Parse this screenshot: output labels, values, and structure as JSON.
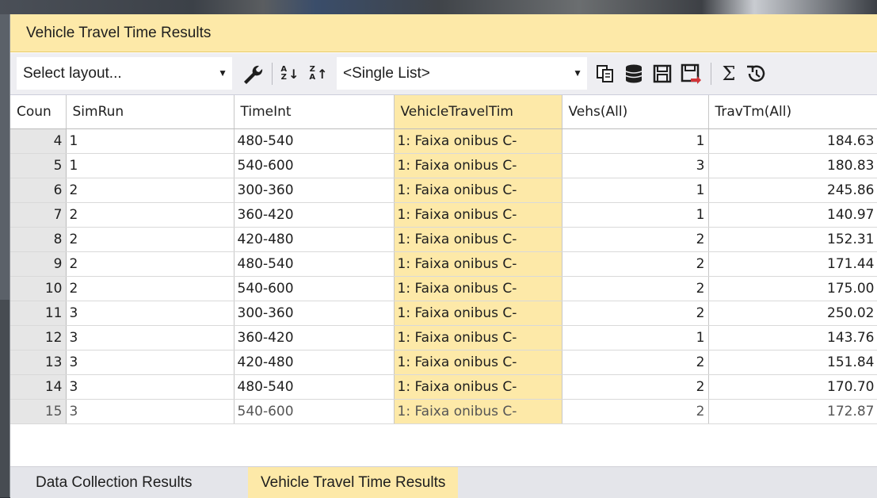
{
  "window": {
    "title": "Vehicle Travel Time Results"
  },
  "toolbar": {
    "layout_select": "Select layout...",
    "list_select": "<Single List>",
    "icons": [
      "wrench-icon",
      "sort-ascending-icon",
      "sort-descending-icon",
      "copy-icon",
      "database-icon",
      "save-icon",
      "save-export-icon",
      "sum-icon",
      "history-icon"
    ]
  },
  "table": {
    "columns": [
      "Coun",
      "SimRun",
      "TimeInt",
      "VehicleTravelTim",
      "Vehs(All)",
      "TravTm(All)"
    ],
    "rows": [
      {
        "count": "4",
        "simrun": "1",
        "timeint": "480-540",
        "vtt": "1: Faixa onibus C-",
        "vehs": "1",
        "travtm": "184.63"
      },
      {
        "count": "5",
        "simrun": "1",
        "timeint": "540-600",
        "vtt": "1: Faixa onibus C-",
        "vehs": "3",
        "travtm": "180.83"
      },
      {
        "count": "6",
        "simrun": "2",
        "timeint": "300-360",
        "vtt": "1: Faixa onibus C-",
        "vehs": "1",
        "travtm": "245.86"
      },
      {
        "count": "7",
        "simrun": "2",
        "timeint": "360-420",
        "vtt": "1: Faixa onibus C-",
        "vehs": "1",
        "travtm": "140.97"
      },
      {
        "count": "8",
        "simrun": "2",
        "timeint": "420-480",
        "vtt": "1: Faixa onibus C-",
        "vehs": "2",
        "travtm": "152.31"
      },
      {
        "count": "9",
        "simrun": "2",
        "timeint": "480-540",
        "vtt": "1: Faixa onibus C-",
        "vehs": "2",
        "travtm": "171.44"
      },
      {
        "count": "10",
        "simrun": "2",
        "timeint": "540-600",
        "vtt": "1: Faixa onibus C-",
        "vehs": "2",
        "travtm": "175.00"
      },
      {
        "count": "11",
        "simrun": "3",
        "timeint": "300-360",
        "vtt": "1: Faixa onibus C-",
        "vehs": "2",
        "travtm": "250.02"
      },
      {
        "count": "12",
        "simrun": "3",
        "timeint": "360-420",
        "vtt": "1: Faixa onibus C-",
        "vehs": "1",
        "travtm": "143.76"
      },
      {
        "count": "13",
        "simrun": "3",
        "timeint": "420-480",
        "vtt": "1: Faixa onibus C-",
        "vehs": "2",
        "travtm": "151.84"
      },
      {
        "count": "14",
        "simrun": "3",
        "timeint": "480-540",
        "vtt": "1: Faixa onibus C-",
        "vehs": "2",
        "travtm": "170.70"
      },
      {
        "count": "15",
        "simrun": "3",
        "timeint": "540-600",
        "vtt": "1: Faixa onibus C-",
        "vehs": "2",
        "travtm": "172.87"
      }
    ]
  },
  "tabs": [
    {
      "label": "Data Collection Results",
      "active": false
    },
    {
      "label": "Vehicle Travel Time Results",
      "active": true
    }
  ],
  "colors": {
    "accent": "#fde9a8",
    "row_header": "#e6e6e6",
    "toolbar": "#eeeef2",
    "tabbar": "#e4e5ea"
  }
}
